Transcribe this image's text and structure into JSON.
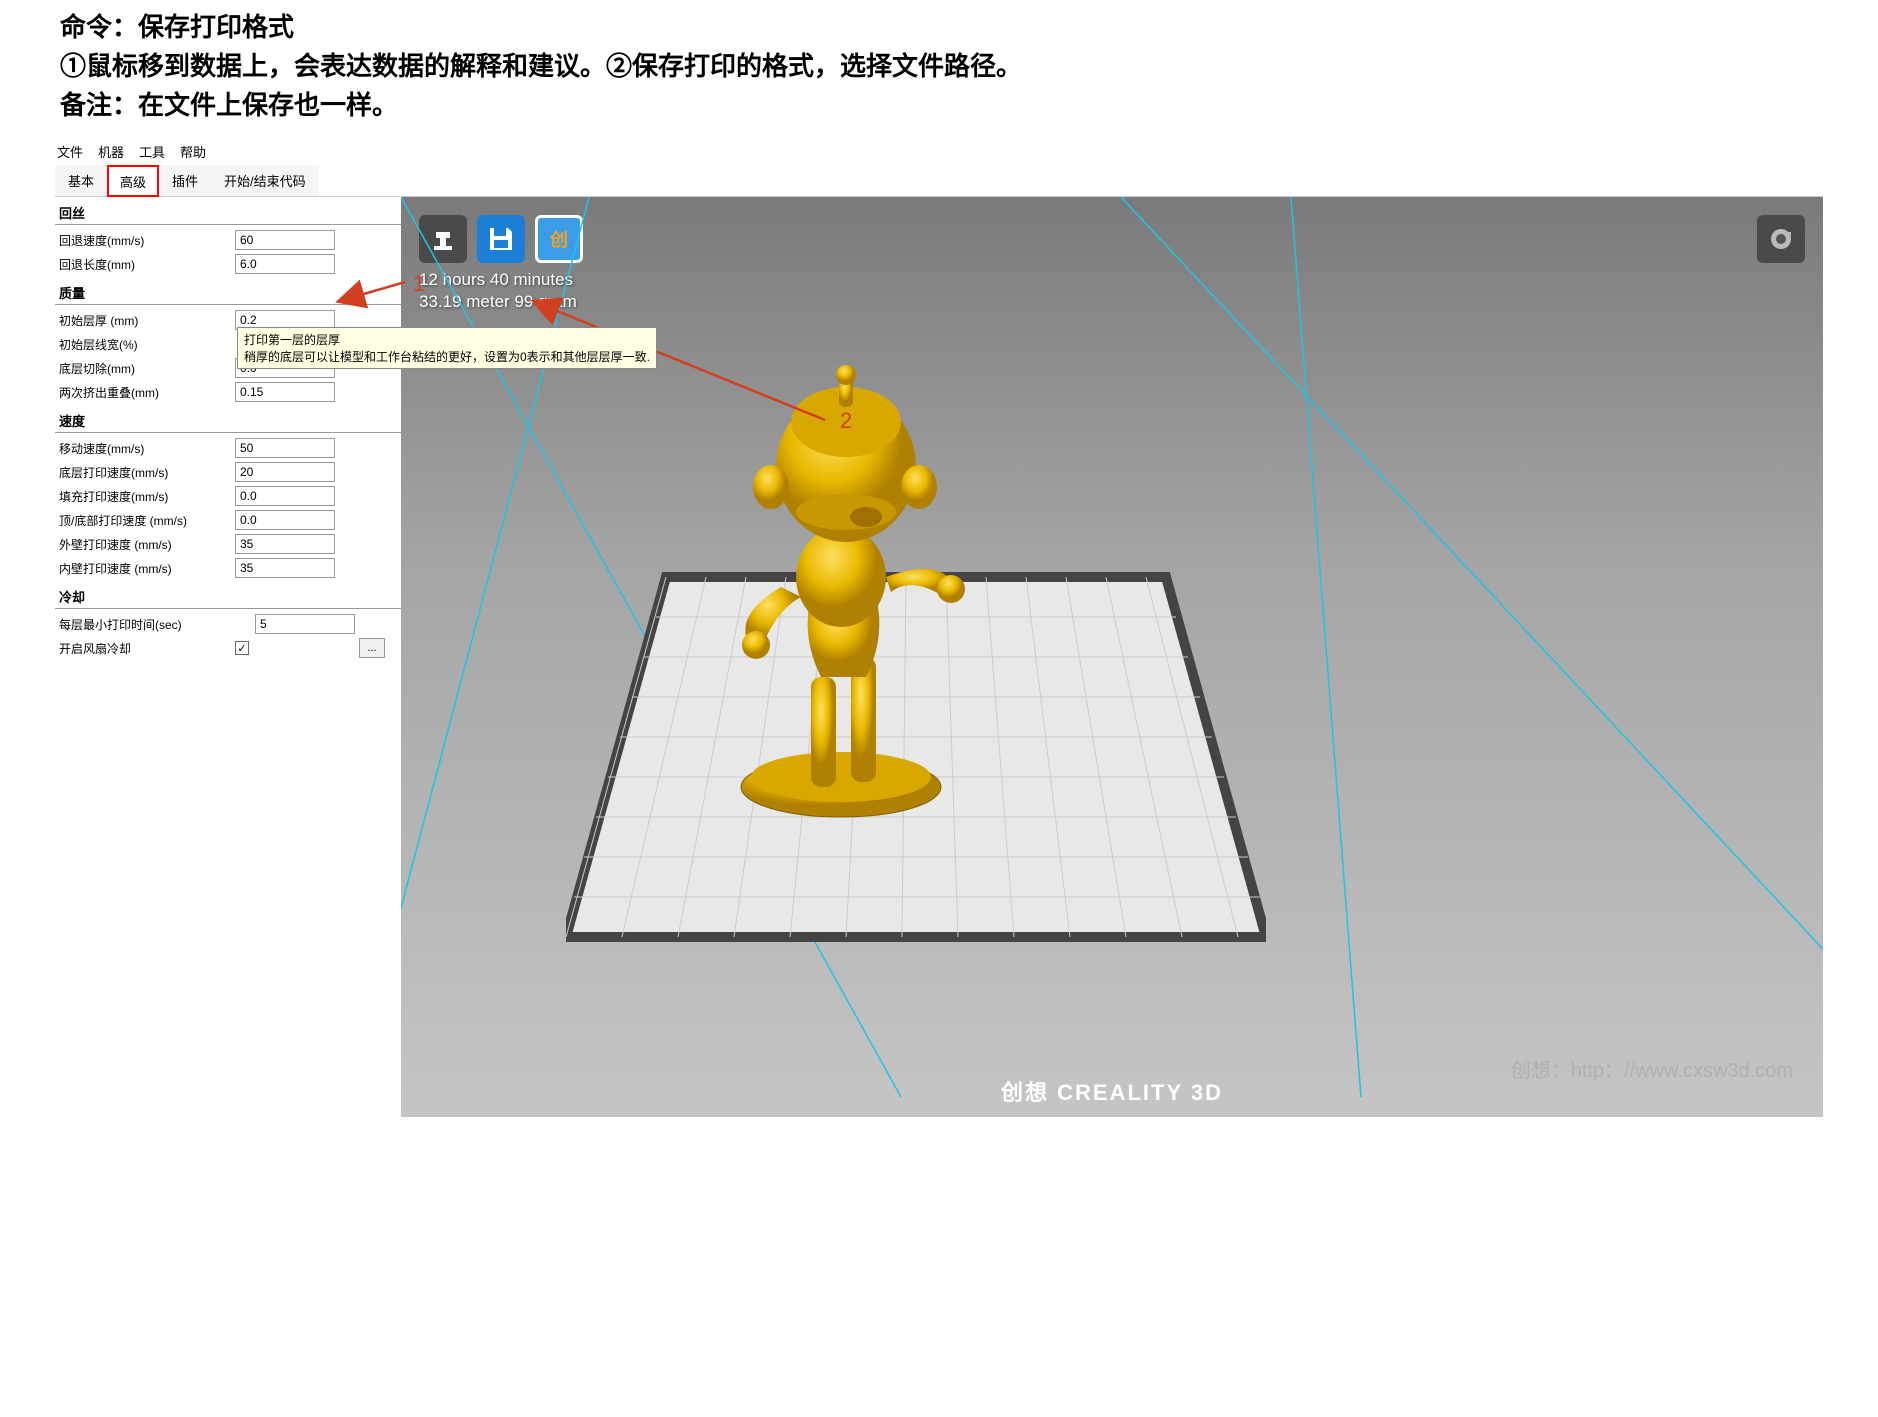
{
  "header": {
    "line1": "命令：保存打印格式",
    "line2": "①鼠标移到数据上，会表达数据的解释和建议。②保存打印的格式，选择文件路径。",
    "line3": "备注：在文件上保存也一样。"
  },
  "menu": {
    "file": "文件",
    "machine": "机器",
    "tools": "工具",
    "help": "帮助"
  },
  "tabs": {
    "basic": "基本",
    "advanced": "高级",
    "plugins": "插件",
    "startend": "开始/结束代码"
  },
  "sections": {
    "retraction": {
      "title": "回丝",
      "speed_label": "回退速度(mm/s)",
      "speed_value": "60",
      "length_label": "回退长度(mm)",
      "length_value": "6.0"
    },
    "quality": {
      "title": "质量",
      "initial_layer_label": "初始层厚 (mm)",
      "initial_layer_value": "0.2",
      "initial_linewidth_label": "初始层线宽(%)",
      "initial_linewidth_value": "",
      "bottom_cut_label": "底层切除(mm)",
      "bottom_cut_value": "0.0",
      "dual_overlap_label": "两次挤出重叠(mm)",
      "dual_overlap_value": "0.15"
    },
    "speed": {
      "title": "速度",
      "travel_label": "移动速度(mm/s)",
      "travel_value": "50",
      "bottom_label": "底层打印速度(mm/s)",
      "bottom_value": "20",
      "infill_label": "填充打印速度(mm/s)",
      "infill_value": "0.0",
      "topbottom_label": "顶/底部打印速度 (mm/s)",
      "topbottom_value": "0.0",
      "outer_label": "外壁打印速度 (mm/s)",
      "outer_value": "35",
      "inner_label": "内壁打印速度 (mm/s)",
      "inner_value": "35"
    },
    "cooling": {
      "title": "冷却",
      "minlayer_label": "每层最小打印时间(sec)",
      "minlayer_value": "5",
      "fan_label": "开启风扇冷却",
      "fan_checked": "✓"
    }
  },
  "tooltip": {
    "line1": "打印第一层的层厚",
    "line2": "稍厚的底层可以让模型和工作台粘结的更好，设置为0表示和其他层层厚一致."
  },
  "viewport": {
    "info_line1": "12 hours 40 minutes",
    "info_line2": "33.19 meter 99 gram",
    "brand": "创想 CREALITY 3D"
  },
  "annotations": {
    "num1": "1",
    "num2": "2"
  },
  "watermark": "创想：http：//www.cxsw3d.com",
  "ellipsis": "..."
}
